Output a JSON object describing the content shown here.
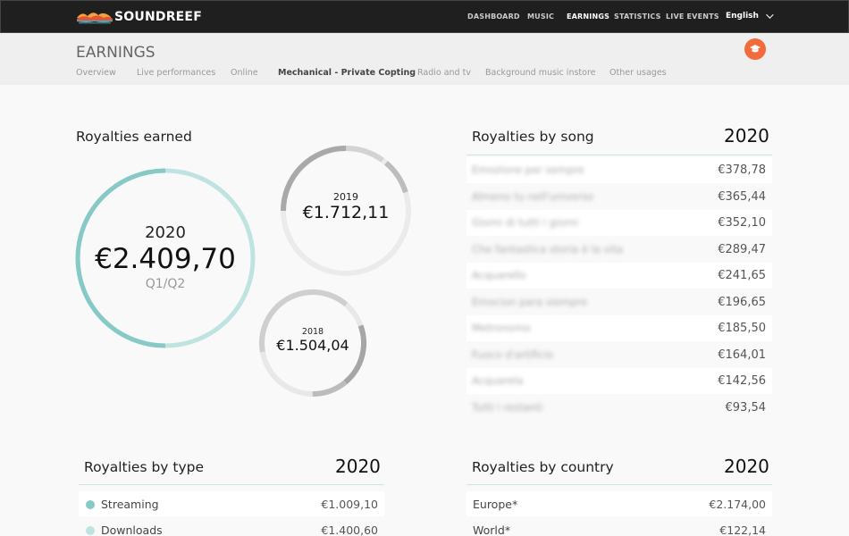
{
  "app": {
    "brand": "SOUNDREEF"
  },
  "nav": {
    "items": [
      {
        "label": "DASHBOARD",
        "active": false
      },
      {
        "label": "MUSIC",
        "active": false
      },
      {
        "label": "EARNINGS",
        "active": true
      },
      {
        "label": "STATISTICS",
        "active": false
      },
      {
        "label": "LIVE EVENTS",
        "active": false
      }
    ],
    "language": "English"
  },
  "header": {
    "title": "EARNINGS",
    "tabs": [
      {
        "label": "Overview",
        "active": false
      },
      {
        "label": "Live performances",
        "active": false
      },
      {
        "label": "Online",
        "active": false
      },
      {
        "label": "Mechanical - Private Copting",
        "active": true
      },
      {
        "label": "Radio and tv",
        "active": false
      },
      {
        "label": "Background music instore",
        "active": false
      },
      {
        "label": "Other usages",
        "active": false
      }
    ]
  },
  "royalties_earned": {
    "title": "Royalties earned",
    "current": {
      "year": "2020",
      "amount": "€2.409,70",
      "period": "Q1/Q2",
      "progress": 0.5
    },
    "prev1": {
      "year": "2019",
      "amount": "€1.712,11"
    },
    "prev2": {
      "year": "2018",
      "amount": "€1.504,04"
    }
  },
  "by_song": {
    "title": "Royalties by song",
    "year": "2020",
    "rows": [
      {
        "name": "Emozione per sempre",
        "value": "€378,78"
      },
      {
        "name": "Almeno tu nell'universo",
        "value": "€365,44"
      },
      {
        "name": "Giorni di tutti i giorni",
        "value": "€352,10"
      },
      {
        "name": "Che fantastica storia è la vita",
        "value": "€289,47"
      },
      {
        "name": "Acquarello",
        "value": "€241,65"
      },
      {
        "name": "Emocion para siempre",
        "value": "€196,65"
      },
      {
        "name": "Metronomo",
        "value": "€185,50"
      },
      {
        "name": "Fuoco d'artificio",
        "value": "€164,01"
      },
      {
        "name": "Acquarela",
        "value": "€142,56"
      },
      {
        "name": "Tutti i restanti",
        "value": "€93,54"
      }
    ]
  },
  "by_type": {
    "title": "Royalties by type",
    "year": "2020",
    "rows": [
      {
        "label": "Streaming",
        "value": "€1.009,10",
        "color": "#86c9c6"
      },
      {
        "label": "Downloads",
        "value": "€1.400,60",
        "color": "#bfe3e0"
      }
    ]
  },
  "by_country": {
    "title": "Royalties by country",
    "year": "2020",
    "rows": [
      {
        "label": "Europe*",
        "value": "€2.174,00"
      },
      {
        "label": "World*",
        "value": "€122,14"
      }
    ]
  },
  "colors": {
    "accent": "#f26b3a",
    "teal": "#86c9c6",
    "teal_light": "#bfe3e0",
    "gray_ring": "#a6a6a6",
    "gray_ring_light": "#e6e6e6"
  }
}
